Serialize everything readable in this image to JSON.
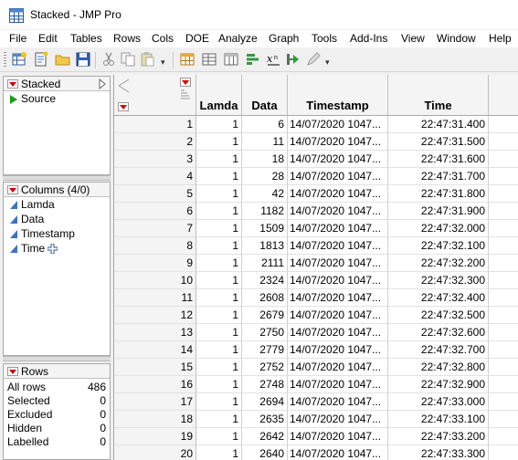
{
  "window": {
    "title": "Stacked - JMP Pro"
  },
  "menu": [
    "File",
    "Edit",
    "Tables",
    "Rows",
    "Cols",
    "DOE",
    "Analyze",
    "Graph",
    "Tools",
    "Add-Ins",
    "View",
    "Window",
    "Help"
  ],
  "toolbar": {
    "icons": [
      "new-data-table-icon",
      "new-script-icon",
      "open-folder-icon",
      "save-icon",
      "cut-icon",
      "copy-icon",
      "paste-icon",
      "data-table-icon",
      "distribution-icon",
      "tabulate-icon",
      "graph-builder-icon",
      "formula-icon",
      "run-script-icon",
      "pencil-icon"
    ]
  },
  "table_panel": {
    "title": "Stacked",
    "items": [
      "Source"
    ]
  },
  "columns_panel": {
    "title": "Columns (4/0)",
    "items": [
      "Lamda",
      "Data",
      "Timestamp",
      "Time"
    ]
  },
  "rows_panel": {
    "title": "Rows",
    "items": [
      {
        "label": "All rows",
        "value": "486"
      },
      {
        "label": "Selected",
        "value": "0"
      },
      {
        "label": "Excluded",
        "value": "0"
      },
      {
        "label": "Hidden",
        "value": "0"
      },
      {
        "label": "Labelled",
        "value": "0"
      }
    ]
  },
  "grid": {
    "columns": [
      "Lamda",
      "Data",
      "Timestamp",
      "Time"
    ],
    "rows": [
      [
        "1",
        "1",
        "6",
        "14/07/2020 1047...",
        "22:47:31.400"
      ],
      [
        "2",
        "1",
        "11",
        "14/07/2020 1047...",
        "22:47:31.500"
      ],
      [
        "3",
        "1",
        "18",
        "14/07/2020 1047...",
        "22:47:31.600"
      ],
      [
        "4",
        "1",
        "28",
        "14/07/2020 1047...",
        "22:47:31.700"
      ],
      [
        "5",
        "1",
        "42",
        "14/07/2020 1047...",
        "22:47:31.800"
      ],
      [
        "6",
        "1",
        "1182",
        "14/07/2020 1047...",
        "22:47:31.900"
      ],
      [
        "7",
        "1",
        "1509",
        "14/07/2020 1047...",
        "22:47:32.000"
      ],
      [
        "8",
        "1",
        "1813",
        "14/07/2020 1047...",
        "22:47:32.100"
      ],
      [
        "9",
        "1",
        "2111",
        "14/07/2020 1047...",
        "22:47:32.200"
      ],
      [
        "10",
        "1",
        "2324",
        "14/07/2020 1047...",
        "22:47:32.300"
      ],
      [
        "11",
        "1",
        "2608",
        "14/07/2020 1047...",
        "22:47:32.400"
      ],
      [
        "12",
        "1",
        "2679",
        "14/07/2020 1047...",
        "22:47:32.500"
      ],
      [
        "13",
        "1",
        "2750",
        "14/07/2020 1047...",
        "22:47:32.600"
      ],
      [
        "14",
        "1",
        "2779",
        "14/07/2020 1047...",
        "22:47:32.700"
      ],
      [
        "15",
        "1",
        "2752",
        "14/07/2020 1047...",
        "22:47:32.800"
      ],
      [
        "16",
        "1",
        "2748",
        "14/07/2020 1047...",
        "22:47:32.900"
      ],
      [
        "17",
        "1",
        "2694",
        "14/07/2020 1047...",
        "22:47:33.000"
      ],
      [
        "18",
        "1",
        "2635",
        "14/07/2020 1047...",
        "22:47:33.100"
      ],
      [
        "19",
        "1",
        "2642",
        "14/07/2020 1047...",
        "22:47:33.200"
      ],
      [
        "20",
        "1",
        "2640",
        "14/07/2020 1047...",
        "22:47:33.300"
      ]
    ]
  }
}
